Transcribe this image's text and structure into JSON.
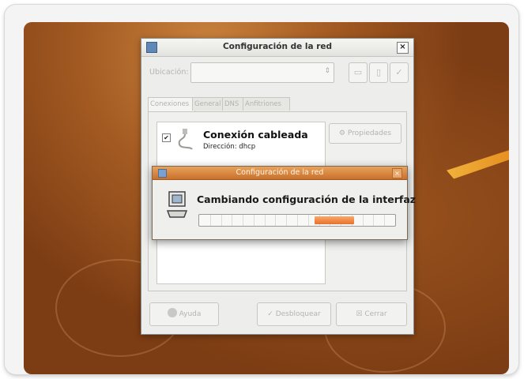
{
  "main_window": {
    "title": "Configuración de la red",
    "close_glyph": "×",
    "location_label": "Ubicación:",
    "location_value": "",
    "tabs": [
      {
        "label": "Conexiones",
        "active": true
      },
      {
        "label": "General",
        "active": false
      },
      {
        "label": "DNS",
        "active": false
      },
      {
        "label": "Anfitriones",
        "active": false
      }
    ],
    "connection": {
      "name": "Conexión cableada",
      "address": "Dirección: dhcp",
      "checked": "✔"
    },
    "properties_button": "Propiedades",
    "help_button": "Ayuda",
    "unlock_button": "Desbloquear",
    "close_button": "Cerrar"
  },
  "progress_dialog": {
    "title": "Configuración de la red",
    "close_glyph": "×",
    "message": "Cambiando configuración de la interfaz",
    "progress_fraction": 0.2
  },
  "colors": {
    "desktop": "#8a4617",
    "dialog_titlebar": "#d5803a",
    "progress_fill": "#ee7a36"
  }
}
